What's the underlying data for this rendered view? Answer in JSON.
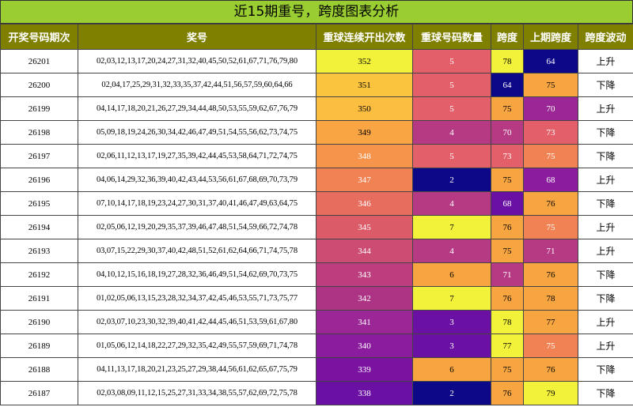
{
  "title": "近15期重号，跨度图表分析",
  "headers": [
    "开奖号码期次",
    "奖号",
    "重球连续开出次数",
    "重球号码数量",
    "跨度",
    "上期跨度",
    "跨度波动"
  ],
  "rows": [
    {
      "period": "26201",
      "numbers": "02,03,12,13,17,20,24,27,31,32,40,45,50,52,61,67,71,76,79,80",
      "consecutive": "352",
      "repeat_count": "5",
      "span": "78",
      "prev_span": "64",
      "trend": "上升"
    },
    {
      "period": "26200",
      "numbers": "02,04,17,25,29,31,32,33,35,37,42,44,51,56,57,59,60,64,66",
      "consecutive": "351",
      "repeat_count": "5",
      "span": "64",
      "prev_span": "75",
      "trend": "下降"
    },
    {
      "period": "26199",
      "numbers": "04,14,17,18,20,21,26,27,29,34,44,48,50,53,55,59,62,67,76,79",
      "consecutive": "350",
      "repeat_count": "5",
      "span": "75",
      "prev_span": "70",
      "trend": "上升"
    },
    {
      "period": "26198",
      "numbers": "05,09,18,19,24,26,30,34,42,46,47,49,51,54,55,56,62,73,74,75",
      "consecutive": "349",
      "repeat_count": "4",
      "span": "70",
      "prev_span": "73",
      "trend": "下降"
    },
    {
      "period": "26197",
      "numbers": "02,06,11,12,13,17,19,27,35,39,42,44,45,53,58,64,71,72,74,75",
      "consecutive": "348",
      "repeat_count": "5",
      "span": "73",
      "prev_span": "75",
      "trend": "下降"
    },
    {
      "period": "26196",
      "numbers": "04,06,14,29,32,36,39,40,42,43,44,53,56,61,67,68,69,70,73,79",
      "consecutive": "347",
      "repeat_count": "2",
      "span": "75",
      "prev_span": "68",
      "trend": "上升"
    },
    {
      "period": "26195",
      "numbers": "07,10,14,17,18,19,23,24,27,30,31,37,40,41,46,47,49,63,64,75",
      "consecutive": "346",
      "repeat_count": "4",
      "span": "68",
      "prev_span": "76",
      "trend": "下降"
    },
    {
      "period": "26194",
      "numbers": "02,05,06,12,19,20,29,35,37,39,46,47,48,51,54,59,66,72,74,78",
      "consecutive": "345",
      "repeat_count": "7",
      "span": "76",
      "prev_span": "75",
      "trend": "上升"
    },
    {
      "period": "26193",
      "numbers": "03,07,15,22,29,30,37,40,42,48,51,52,61,62,64,66,71,74,75,78",
      "consecutive": "344",
      "repeat_count": "4",
      "span": "75",
      "prev_span": "71",
      "trend": "上升"
    },
    {
      "period": "26192",
      "numbers": "04,10,12,15,16,18,19,27,28,32,36,46,49,51,54,62,69,70,73,75",
      "consecutive": "343",
      "repeat_count": "6",
      "span": "71",
      "prev_span": "76",
      "trend": "下降"
    },
    {
      "period": "26191",
      "numbers": "01,02,05,06,13,15,23,28,32,34,37,42,45,46,53,55,71,73,75,77",
      "consecutive": "342",
      "repeat_count": "7",
      "span": "76",
      "prev_span": "78",
      "trend": "下降"
    },
    {
      "period": "26190",
      "numbers": "02,03,07,10,23,30,32,39,40,41,42,44,45,46,51,53,59,61,67,80",
      "consecutive": "341",
      "repeat_count": "3",
      "span": "78",
      "prev_span": "77",
      "trend": "上升"
    },
    {
      "period": "26189",
      "numbers": "01,05,06,12,14,18,22,27,29,32,35,42,49,55,57,59,69,71,74,78",
      "consecutive": "340",
      "repeat_count": "3",
      "span": "77",
      "prev_span": "75",
      "trend": "上升"
    },
    {
      "period": "26188",
      "numbers": "04,11,13,17,18,20,21,23,25,27,29,38,44,56,61,62,65,67,75,79",
      "consecutive": "339",
      "repeat_count": "6",
      "span": "75",
      "prev_span": "76",
      "trend": "下降"
    },
    {
      "period": "26187",
      "numbers": "02,03,08,09,11,12,15,25,27,31,33,34,38,55,57,62,69,72,75,78",
      "consecutive": "338",
      "repeat_count": "2",
      "span": "76",
      "prev_span": "79",
      "trend": "下降"
    }
  ],
  "colors": {
    "title_bg": "#9acd32",
    "header_bg": "#808000",
    "consecutive": [
      "#f2f23a",
      "#fbc43e",
      "#fbbe40",
      "#f9a543",
      "#f6944c",
      "#f18254",
      "#e76e5e",
      "#db5c68",
      "#cd4c73",
      "#bd3e7e",
      "#ad3384",
      "#9a2795",
      "#8a1c9d",
      "#7a14a0",
      "#6a10a3"
    ],
    "repeat_count": [
      "#e35f6a",
      "#e35f6a",
      "#e35f6a",
      "#b53a83",
      "#e35f6a",
      "#0d0887",
      "#b53a83",
      "#f2f23a",
      "#b53a83",
      "#f7a540",
      "#f2f23a",
      "#6a10a3",
      "#6a10a3",
      "#f7a540",
      "#0d0887"
    ],
    "span": [
      "#f2f23a",
      "#0d0887",
      "#f7a540",
      "#b53a83",
      "#e35f6a",
      "#f7a540",
      "#6a10a3",
      "#f7a540",
      "#f7a540",
      "#b53a83",
      "#f7a540",
      "#f2f23a",
      "#f2f23a",
      "#f7a540",
      "#f7a540"
    ],
    "prev_span": [
      "#0d0887",
      "#f7a540",
      "#9a2795",
      "#e35f6a",
      "#f18254",
      "#8a1c9d",
      "#f7a540",
      "#f18254",
      "#b53a83",
      "#f7a540",
      "#f7a540",
      "#f7a540",
      "#f18254",
      "#f7a540",
      "#f2f23a"
    ]
  }
}
